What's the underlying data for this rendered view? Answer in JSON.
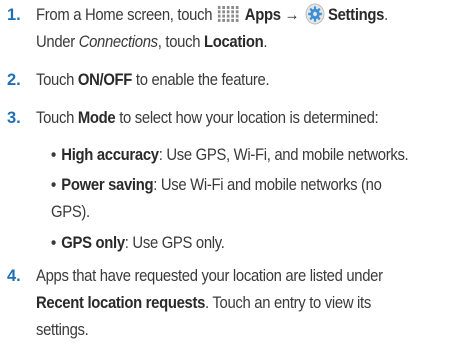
{
  "steps": [
    {
      "number": "1.",
      "t1": "From a Home screen, touch",
      "apps": "Apps",
      "arrow": "→",
      "settings": "Settings",
      "period": ".",
      "t2": "Under",
      "connections": "Connections",
      "t3": ", touch",
      "location": "Location",
      "t4": "."
    },
    {
      "number": "2.",
      "t1": "Touch",
      "onoff": "ON/OFF",
      "t2": "to enable the feature."
    },
    {
      "number": "3.",
      "t1": "Touch",
      "mode": "Mode",
      "t2": "to select how your location is determined:"
    },
    {
      "number": "4.",
      "t1": "Apps that have requested your location are listed under",
      "recent": "Recent location requests",
      "t2": ". Touch an entry to view its",
      "t3": "settings."
    }
  ],
  "bullet_char": "•",
  "modes": [
    {
      "name": "High accuracy",
      "desc": ": Use GPS, Wi-Fi, and mobile networks."
    },
    {
      "name": "Power saving",
      "desc": ": Use Wi-Fi and mobile networks (no",
      "desc2": "GPS)."
    },
    {
      "name": "GPS only",
      "desc": ": Use GPS only."
    }
  ],
  "icons": {
    "apps": "apps-grid-icon",
    "settings": "settings-gear-icon"
  },
  "colors": {
    "step_number": "#1f6fb8",
    "apps_icon": "#8a8a8a",
    "settings_icon": "#3d8fd6"
  }
}
